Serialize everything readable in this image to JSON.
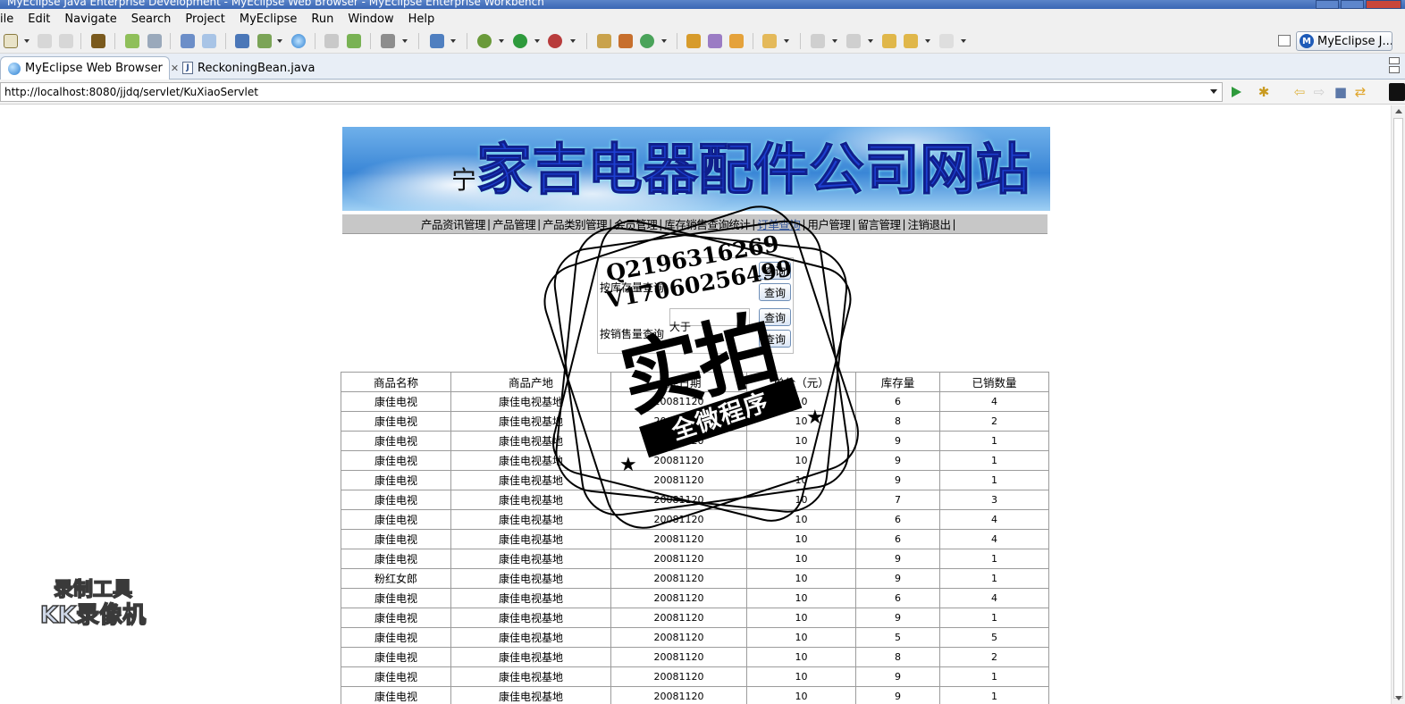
{
  "window": {
    "title": "MyEclipse Java Enterprise Development - MyEclipse Web Browser - MyEclipse Enterprise Workbench"
  },
  "menu": [
    "ile",
    "Edit",
    "Navigate",
    "Search",
    "Project",
    "MyEclipse",
    "Run",
    "Window",
    "Help"
  ],
  "toolbar": {
    "perspective_label": "MyEclipse J..."
  },
  "tabs": [
    {
      "label": "MyEclipse Web Browser",
      "active": true
    },
    {
      "label": "ReckoningBean.java",
      "active": false
    }
  ],
  "address": {
    "url": "http://localhost:8080/jjdq/servlet/KuXiaoServlet"
  },
  "page": {
    "banner_prefix": "宁",
    "banner_title": "家吉电器配件公司网站",
    "nav": [
      "产品资讯管理",
      "产品管理",
      "产品类别管理",
      "会员管理",
      "库存销售查询统计",
      "订单查询",
      "用户管理",
      "留言管理",
      "注销退出"
    ],
    "query": {
      "row1_label": "按库存量查询",
      "row2_label": "按销售量查询",
      "row2_op": "大于",
      "button_label": "查询"
    },
    "table": {
      "headers": [
        "商品名称",
        "商品产地",
        "入库日期",
        "单价（元）",
        "库存量",
        "已销数量"
      ],
      "rows": [
        [
          "康佳电视",
          "康佳电视基地",
          "20081120",
          "10",
          "6",
          "4"
        ],
        [
          "康佳电视",
          "康佳电视基地",
          "20081120",
          "10",
          "8",
          "2"
        ],
        [
          "康佳电视",
          "康佳电视基地",
          "20081120",
          "10",
          "9",
          "1"
        ],
        [
          "康佳电视",
          "康佳电视基地",
          "20081120",
          "10",
          "9",
          "1"
        ],
        [
          "康佳电视",
          "康佳电视基地",
          "20081120",
          "10",
          "9",
          "1"
        ],
        [
          "康佳电视",
          "康佳电视基地",
          "20081120",
          "10",
          "7",
          "3"
        ],
        [
          "康佳电视",
          "康佳电视基地",
          "20081120",
          "10",
          "6",
          "4"
        ],
        [
          "康佳电视",
          "康佳电视基地",
          "20081120",
          "10",
          "6",
          "4"
        ],
        [
          "康佳电视",
          "康佳电视基地",
          "20081120",
          "10",
          "9",
          "1"
        ],
        [
          "粉红女郎",
          "康佳电视基地",
          "20081120",
          "10",
          "9",
          "1"
        ],
        [
          "康佳电视",
          "康佳电视基地",
          "20081120",
          "10",
          "6",
          "4"
        ],
        [
          "康佳电视",
          "康佳电视基地",
          "20081120",
          "10",
          "9",
          "1"
        ],
        [
          "康佳电视",
          "康佳电视基地",
          "20081120",
          "10",
          "5",
          "5"
        ],
        [
          "康佳电视",
          "康佳电视基地",
          "20081120",
          "10",
          "8",
          "2"
        ],
        [
          "康佳电视",
          "康佳电视基地",
          "20081120",
          "10",
          "9",
          "1"
        ],
        [
          "康佳电视",
          "康佳电视基地",
          "20081120",
          "10",
          "9",
          "1"
        ]
      ]
    }
  },
  "watermark": {
    "qq": "Q2196316269",
    "v": "V17060256499",
    "big": "实拍",
    "ribbon": "全微程序"
  },
  "recorder": {
    "line1": "录制工具",
    "line2": "KK录像机"
  }
}
